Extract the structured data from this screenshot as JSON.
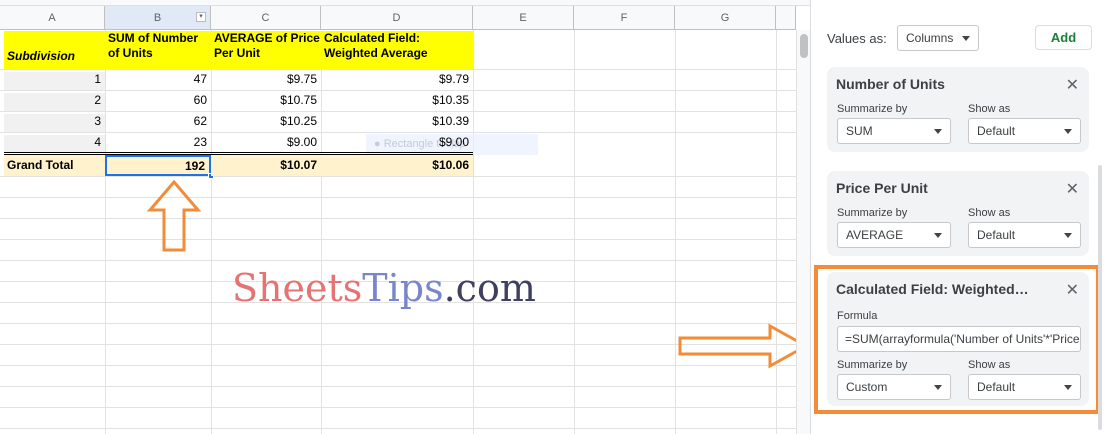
{
  "columns": [
    "A",
    "B",
    "C",
    "D",
    "E",
    "F",
    "G"
  ],
  "pivot": {
    "headers": {
      "a": "Subdivision",
      "b": "SUM of Number of Units",
      "c": "AVERAGE of Price Per Unit",
      "d": "Calculated Field: Weighted Average"
    },
    "rows": [
      {
        "sub": "1",
        "units": "47",
        "avg": "$9.75",
        "wavg": "$9.79"
      },
      {
        "sub": "2",
        "units": "60",
        "avg": "$10.75",
        "wavg": "$10.35"
      },
      {
        "sub": "3",
        "units": "62",
        "avg": "$10.25",
        "wavg": "$10.39"
      },
      {
        "sub": "4",
        "units": "23",
        "avg": "$9.00",
        "wavg": "$9.00"
      }
    ],
    "total": {
      "label": "Grand Total",
      "units": "192",
      "avg": "$10.07",
      "wavg": "$10.06"
    }
  },
  "chip_text": "Rectangle tooltip",
  "watermark": {
    "part1": "Sheets",
    "part2": "Tips",
    "part3": ".com"
  },
  "panel": {
    "values_as_label": "Values as:",
    "values_as_value": "Columns",
    "add_label": "Add",
    "cards": [
      {
        "title": "Number of Units",
        "summarize_label": "Summarize by",
        "summarize_value": "SUM",
        "show_label": "Show as",
        "show_value": "Default"
      },
      {
        "title": "Price Per Unit",
        "summarize_label": "Summarize by",
        "summarize_value": "AVERAGE",
        "show_label": "Show as",
        "show_value": "Default"
      },
      {
        "title": "Calculated Field: Weighted…",
        "formula_label": "Formula",
        "formula_value": "=SUM(arrayformula('Number of Units'*'Price",
        "summarize_label": "Summarize by",
        "summarize_value": "Custom",
        "show_label": "Show as",
        "show_value": "Default"
      }
    ],
    "close_glyph": "✕"
  },
  "colors": {
    "header_yellow": "#ffff00",
    "total_bg": "#fff2cc",
    "accent_orange": "#f28c38",
    "add_green": "#188038"
  }
}
